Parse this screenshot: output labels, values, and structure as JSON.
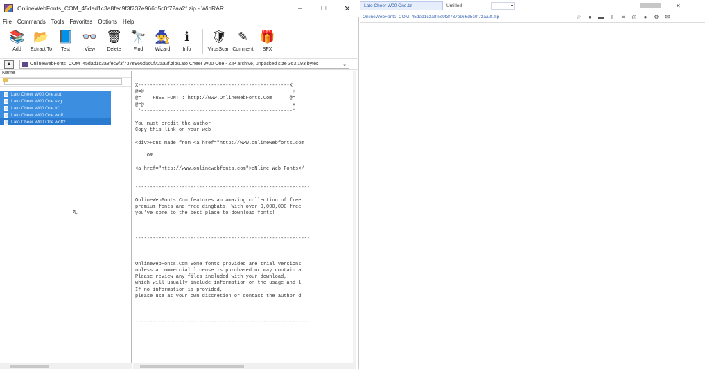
{
  "winrar": {
    "title": "OnlineWebFonts_COM_45dad1c3a8fec9f3f737e966d5c0f72aa2f.zip - WinRAR",
    "controls": {
      "minimize": "–",
      "maximize": "□",
      "close": "✕"
    },
    "menu": [
      "File",
      "Commands",
      "Tools",
      "Favorites",
      "Options",
      "Help"
    ],
    "toolbar": [
      {
        "label": "Add",
        "icon": "add-archive-icon",
        "glyph": "📚"
      },
      {
        "label": "Extract To",
        "icon": "extract-icon",
        "glyph": "📂"
      },
      {
        "label": "Test",
        "icon": "test-icon",
        "glyph": "📘"
      },
      {
        "label": "View",
        "icon": "view-icon",
        "glyph": "👓"
      },
      {
        "label": "Delete",
        "icon": "delete-icon",
        "glyph": "🗑"
      },
      {
        "label": "Find",
        "icon": "find-icon",
        "glyph": "🔭"
      },
      {
        "label": "Wizard",
        "icon": "wizard-icon",
        "glyph": "🧙"
      },
      {
        "label": "Info",
        "icon": "info-icon",
        "glyph": "ℹ"
      },
      {
        "label": "VirusScan",
        "icon": "virusscan-icon",
        "glyph": "🛡"
      },
      {
        "label": "Comment",
        "icon": "comment-icon",
        "glyph": "✎"
      },
      {
        "label": "SFX",
        "icon": "sfx-icon",
        "glyph": "🎁"
      }
    ],
    "address": "OnlineWebFonts_COM_45dad1c3a8fec9f3f737e966d5c0f72aa2f.zip\\Lato Cheer W00 One - ZIP archive, unpacked size 363,193 bytes",
    "column_header": "Name",
    "files": [
      "Lato Cheer W00 One.eot",
      "Lato Cheer W00 One.svg",
      "Lato Cheer W00 One.ttf",
      "Lato Cheer W00 One.woff",
      "Lato Cheer W00 One.woff2"
    ],
    "preview_text": "X----------------------------------------------------X\n@=@                                                   +\n@=    FREE FONT : http://www.OnlineWebFonts.Com      @=\n@=@                                                   +\n *----------------------------------------------------*\n\nYou must credit the author\nCopy this link on your web\n\n<div>Font made from <a href=\"http://www.onlinewebfonts.com\n\n    OR\n\n<a href=\"http://www.onlinewebfonts.com\">oNline Web Fonts</\n\n\n------------------------------------------------------------\n\nOnlineWebFonts.Com features an amazing collection of free\npremium fonts and free dingbats. With over 9,000,000 free\nyou've come to the best place to download fonts!\n\n\n\n------------------------------------------------------------\n\n\n\nOnlineWebFonts.Com Some fonts provided are trial versions\nunless a commercial license is purchased or may contain a\nPlease review any files included with your download,\nwhich will usually include information on the usage and l\nIf no information is provided,\nplease use at your own discretion or contact the author d\n\n\n\n------------------------------------------------------------"
  },
  "rightwin": {
    "tab_active": "Lato Cheer W00 One.txt",
    "tab_second": "Untitled",
    "path": "OnlineWebFonts_COM_45dad1c3a8fec9f3f737e966d5c0f72aa2f.zip",
    "close": "✕",
    "icons": [
      "☆",
      "●",
      "▬",
      "T",
      "⌗",
      "◎",
      "●",
      "⚙",
      "✉"
    ]
  }
}
